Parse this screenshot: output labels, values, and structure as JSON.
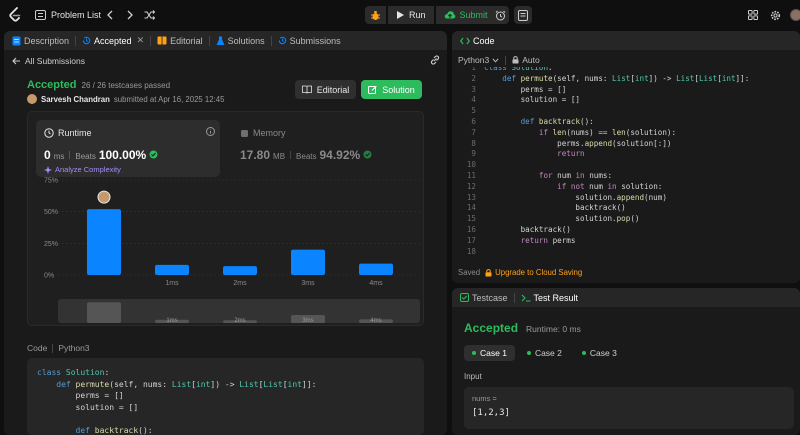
{
  "nav": {
    "title": "Problem List",
    "run_label": "Run",
    "submit_label": "Submit"
  },
  "left_tabs": [
    {
      "label": "Description"
    },
    {
      "label": "Accepted"
    },
    {
      "label": "Editorial"
    },
    {
      "label": "Solutions"
    },
    {
      "label": "Submissions"
    }
  ],
  "submission": {
    "back_label": "All Submissions",
    "status": "Accepted",
    "testcases": "26 / 26 testcases passed",
    "author": "Sarvesh Chandran",
    "submitted_text": "submitted at Apr 16, 2025 12:45",
    "editorial_btn": "Editorial",
    "solution_btn": "Solution"
  },
  "runtime": {
    "title": "Runtime",
    "value": "0",
    "unit": "ms",
    "beats_label": "Beats",
    "beats_value": "100.00%",
    "analyze_label": "Analyze Complexity"
  },
  "memory": {
    "title": "Memory",
    "value": "17.80",
    "unit": "MB",
    "beats_label": "Beats",
    "beats_value": "94.92%"
  },
  "chart_data": {
    "type": "bar",
    "categories": [
      "",
      "1ms",
      "2ms",
      "3ms",
      "4ms"
    ],
    "values": [
      52,
      8,
      7,
      20,
      9
    ],
    "yticks": [
      "75%",
      "50%",
      "25%",
      "0%"
    ],
    "ylim": [
      0,
      75
    ],
    "xlabel": "",
    "ylabel": "",
    "grid": true,
    "mini_labels": [
      "1ms",
      "2ms",
      "3ms",
      "4ms"
    ],
    "bar_color": "#0a84ff"
  },
  "code_section": {
    "label": "Code",
    "lang": "Python3",
    "lines": [
      "class Solution:",
      "    def permute(self, nums: List[int]) -> List[List[int]]:",
      "        perms = []",
      "        solution = []",
      "",
      "        def backtrack():"
    ]
  },
  "editor": {
    "title": "Code",
    "lang": "Python3",
    "mode": "Auto",
    "saved_label": "Saved",
    "upgrade_label": "Upgrade to Cloud Saving",
    "line_numbers": [
      "1",
      "2",
      "3",
      "4",
      "5",
      "6",
      "7",
      "8",
      "9",
      "10",
      "11",
      "12",
      "13",
      "14",
      "15",
      "16",
      "17",
      "18"
    ]
  },
  "testpanel": {
    "tab_testcase": "Testcase",
    "tab_result": "Test Result",
    "status": "Accepted",
    "runtime_text": "Runtime: 0 ms",
    "cases": [
      "Case 1",
      "Case 2",
      "Case 3"
    ],
    "input_label": "Input",
    "var_name": "nums =",
    "var_value": "[1,2,3]"
  },
  "colors": {
    "accent_green": "#2cbb5d",
    "accent_blue": "#0a84ff",
    "accent_orange": "#ffa116"
  }
}
